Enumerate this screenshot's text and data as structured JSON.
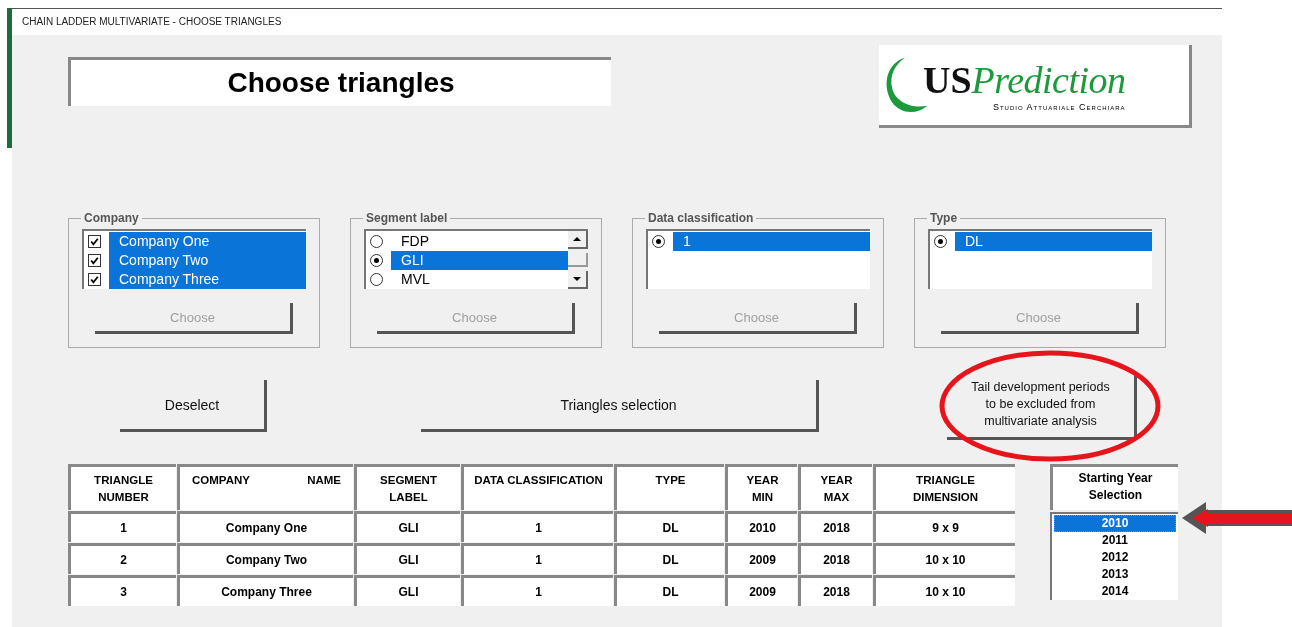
{
  "window": {
    "title": "CHAIN LADDER MULTIVARIATE - CHOOSE TRIANGLES"
  },
  "heading": "Choose triangles",
  "logo": {
    "brand_initials": "US",
    "brand_name": "Prediction",
    "tagline": "Studio Attuariale Cerchiara"
  },
  "groups": [
    {
      "legend": "Company",
      "kind": "checkbox",
      "scrollbar": false,
      "items": [
        {
          "label": "Company One",
          "checked": true,
          "selected": true
        },
        {
          "label": "Company Two",
          "checked": true,
          "selected": true
        },
        {
          "label": "Company Three",
          "checked": true,
          "selected": true
        }
      ],
      "button": {
        "label": "Choose",
        "disabled": true
      }
    },
    {
      "legend": "Segment label",
      "kind": "radio",
      "scrollbar": true,
      "items": [
        {
          "label": "FDP",
          "checked": false,
          "selected": false
        },
        {
          "label": "GLI",
          "checked": true,
          "selected": true
        },
        {
          "label": "MVL",
          "checked": false,
          "selected": false
        }
      ],
      "button": {
        "label": "Choose",
        "disabled": true
      }
    },
    {
      "legend": "Data classification",
      "kind": "radio",
      "scrollbar": false,
      "items": [
        {
          "label": "1",
          "checked": true,
          "selected": true
        }
      ],
      "button": {
        "label": "Choose",
        "disabled": true
      }
    },
    {
      "legend": "Type",
      "kind": "radio",
      "scrollbar": false,
      "items": [
        {
          "label": "DL",
          "checked": true,
          "selected": true
        }
      ],
      "button": {
        "label": "Choose",
        "disabled": true
      }
    }
  ],
  "buttons": {
    "deselect": "Deselect",
    "triangles_selection": "Triangles selection",
    "tail": "Tail development periods to be excluded from multivariate analysis"
  },
  "annotations": {
    "tail_circle": true,
    "year_arrow": true
  },
  "table": {
    "columns": [
      "TRIANGLE NUMBER",
      "COMPANY NAME",
      "SEGMENT LABEL",
      "DATA CLASSIFICATION",
      "TYPE",
      "YEAR MIN",
      "YEAR MAX",
      "TRIANGLE DIMENSION"
    ],
    "rows": [
      [
        "1",
        "Company One",
        "GLI",
        "1",
        "DL",
        "2010",
        "2018",
        "9 x 9"
      ],
      [
        "2",
        "Company Two",
        "GLI",
        "1",
        "DL",
        "2009",
        "2018",
        "10 x 10"
      ],
      [
        "3",
        "Company Three",
        "GLI",
        "1",
        "DL",
        "2009",
        "2018",
        "10 x 10"
      ]
    ]
  },
  "starting_year": {
    "heading": "Starting Year Selection",
    "years": [
      {
        "label": "2010",
        "selected": true
      },
      {
        "label": "2011",
        "selected": false
      },
      {
        "label": "2012",
        "selected": false
      },
      {
        "label": "2013",
        "selected": false
      },
      {
        "label": "2014",
        "selected": false
      }
    ]
  }
}
